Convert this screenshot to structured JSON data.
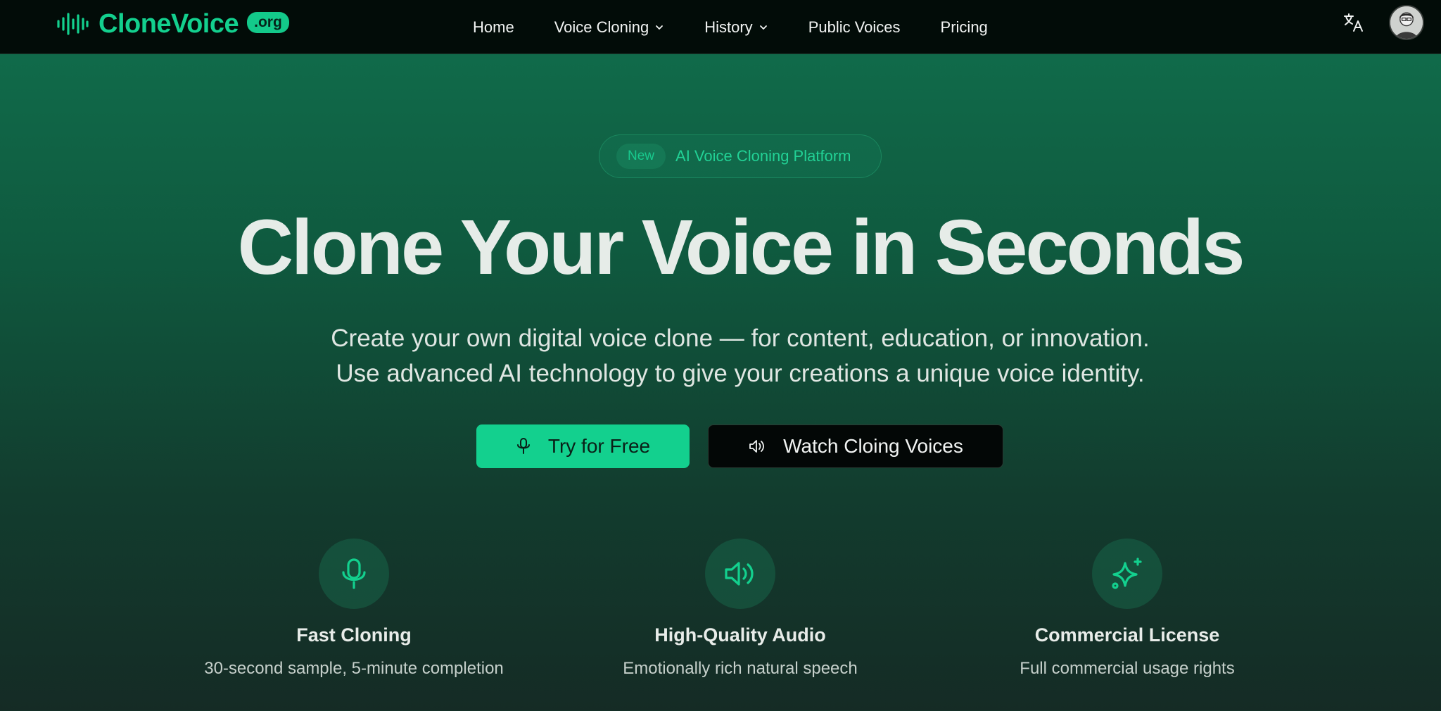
{
  "header": {
    "logo_text": "CloneVoice",
    "logo_badge": ".org",
    "nav": [
      {
        "label": "Home"
      },
      {
        "label": "Voice Cloning"
      },
      {
        "label": "History"
      },
      {
        "label": "Public Voices"
      },
      {
        "label": "Pricing"
      }
    ]
  },
  "hero": {
    "pill_badge": "New",
    "pill_text": "AI Voice Cloning Platform",
    "title": "Clone Your Voice in Seconds",
    "subtitle_line1": "Create your own digital voice clone — for content, education, or innovation.",
    "subtitle_line2": "Use advanced AI technology to give your creations a unique voice identity.",
    "primary_button": "Try for Free",
    "secondary_button": "Watch Cloing Voices"
  },
  "features": [
    {
      "icon": "microphone-icon",
      "title": "Fast Cloning",
      "desc": "30-second sample, 5-minute completion"
    },
    {
      "icon": "speaker-icon",
      "title": "High-Quality Audio",
      "desc": "Emotionally rich natural speech"
    },
    {
      "icon": "sparkles-icon",
      "title": "Commercial License",
      "desc": "Full commercial usage rights"
    }
  ],
  "colors": {
    "accent": "#13d08e",
    "nav_bg": "#020c08",
    "hero_top": "#116f4d",
    "hero_bottom": "#152b25"
  }
}
